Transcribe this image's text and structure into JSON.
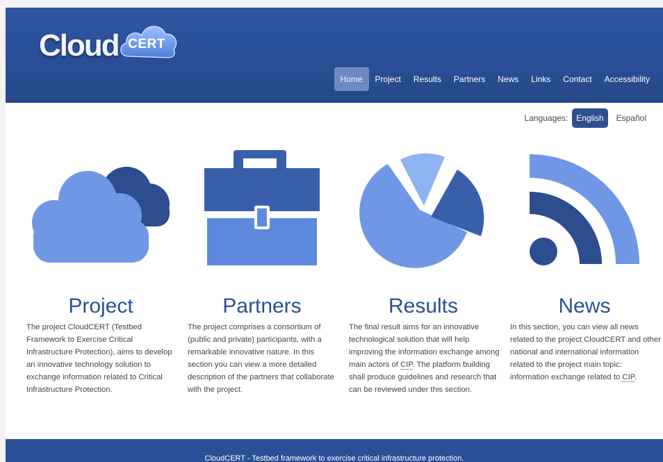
{
  "logo": {
    "word": "Cloud",
    "badge": "CERT"
  },
  "nav": {
    "items": [
      {
        "label": "Home"
      },
      {
        "label": "Project"
      },
      {
        "label": "Results"
      },
      {
        "label": "Partners"
      },
      {
        "label": "News"
      },
      {
        "label": "Links"
      },
      {
        "label": "Contact"
      },
      {
        "label": "Accessibility"
      }
    ],
    "active_index": 0
  },
  "languages": {
    "label": "Languages:",
    "options": [
      {
        "label": "English"
      },
      {
        "label": "Español"
      }
    ],
    "selected": "English"
  },
  "columns": [
    {
      "title": "Project",
      "icon": "cloud-icon",
      "text_parts": [
        "The project CloudCERT (Testbed Framework to Exercise Critical Infrastructure Protection), aims to develop an innovative technology solution to exchange information related to Critical Infrastructure Protection."
      ]
    },
    {
      "title": "Partners",
      "icon": "briefcase-icon",
      "text_parts": [
        "The project comprises a consortium of (public and private) participants, with a remarkable innovative nature. In this section you can view a more detailed description of the partners that collaborate with the project."
      ]
    },
    {
      "title": "Results",
      "icon": "pie-chart-icon",
      "text_before": "The final result aims for an innovative technological solution that will help improving the information exchange among main actors of ",
      "text_abbr": "CIP",
      "text_after": ". The platform building shall produce guidelines and research that can be reviewed under this section."
    },
    {
      "title": "News",
      "icon": "rss-icon",
      "text_before": "In this section, you can view all news related to the project CloudCERT and other national and international information related to the project main topic: information exchange related to ",
      "text_abbr": "CIP",
      "text_after": "."
    }
  ],
  "footer": {
    "text": "CloudCERT - Testbed framework to exercise critical infrastructure protection."
  },
  "colors": {
    "header": "#2a4f98",
    "icon_light": "#6f97e6",
    "icon_dark": "#2c4d8e",
    "title": "#2a4f98"
  }
}
